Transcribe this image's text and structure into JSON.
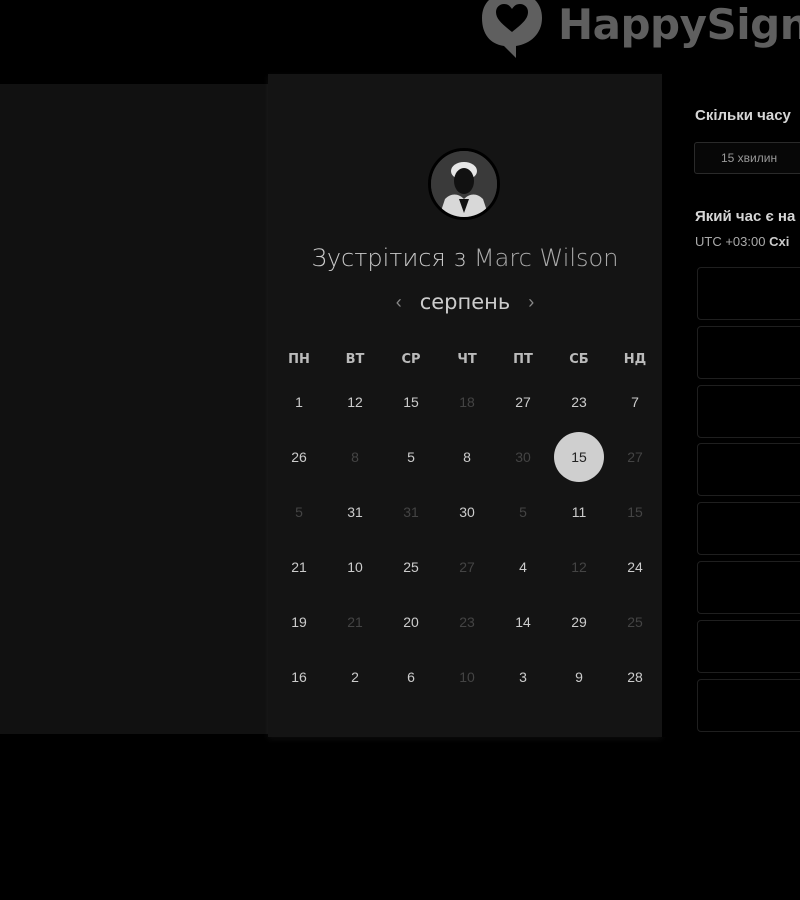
{
  "brand": {
    "name": "HappySigna"
  },
  "colors": {
    "background": "#000000",
    "card": "#141414",
    "selected": "#cfcfcf"
  },
  "host": {
    "prefix": "Зустрітися з",
    "name": "Marc Wilson"
  },
  "calendar": {
    "month": "серпень",
    "weekdays": [
      "ПН",
      "ВТ",
      "СР",
      "ЧТ",
      "ПТ",
      "СБ",
      "НД"
    ],
    "weeks": [
      [
        {
          "d": "1"
        },
        {
          "d": "12"
        },
        {
          "d": "15"
        },
        {
          "d": "18",
          "dim": true
        },
        {
          "d": "27"
        },
        {
          "d": "23"
        },
        {
          "d": "7"
        }
      ],
      [
        {
          "d": "26"
        },
        {
          "d": "8",
          "dim": true
        },
        {
          "d": "5"
        },
        {
          "d": "8"
        },
        {
          "d": "30",
          "dim": true
        },
        {
          "d": "15",
          "sel": true
        },
        {
          "d": "27",
          "dim": true
        }
      ],
      [
        {
          "d": "5",
          "dim": true
        },
        {
          "d": "31"
        },
        {
          "d": "31",
          "dim": true
        },
        {
          "d": "30"
        },
        {
          "d": "5",
          "dim": true
        },
        {
          "d": "11"
        },
        {
          "d": "15",
          "dim": true
        }
      ],
      [
        {
          "d": "21"
        },
        {
          "d": "10"
        },
        {
          "d": "25"
        },
        {
          "d": "27",
          "dim": true
        },
        {
          "d": "4"
        },
        {
          "d": "12",
          "dim": true
        },
        {
          "d": "24"
        }
      ],
      [
        {
          "d": "19"
        },
        {
          "d": "21",
          "dim": true
        },
        {
          "d": "20"
        },
        {
          "d": "23",
          "dim": true
        },
        {
          "d": "14"
        },
        {
          "d": "29"
        },
        {
          "d": "25",
          "dim": true
        }
      ],
      [
        {
          "d": "16"
        },
        {
          "d": "2"
        },
        {
          "d": "6"
        },
        {
          "d": "10",
          "dim": true
        },
        {
          "d": "3"
        },
        {
          "d": "9"
        },
        {
          "d": "28"
        }
      ]
    ]
  },
  "side": {
    "duration_q": "Скільки часу",
    "duration_value": "15 хвилин",
    "time_q": "Який час є на",
    "tz_offset": "UTC +03:00",
    "tz_name": "Схі",
    "slot_count": 8
  }
}
